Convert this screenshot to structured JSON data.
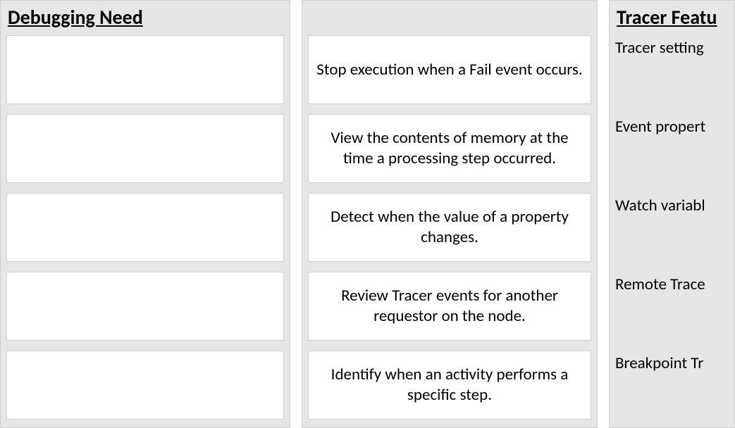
{
  "columns": {
    "left": {
      "header": "Debugging Need",
      "slots": [
        "",
        "",
        "",
        "",
        ""
      ]
    },
    "middle": {
      "cards": [
        "Stop execution when a Fail event occurs.",
        "View the contents of memory at the time a  processing step occurred.",
        "Detect when the value of a property changes.",
        "Review Tracer events for another requestor on the node.",
        "Identify when an activity performs a specific step."
      ]
    },
    "right": {
      "header": "Tracer Featu",
      "features": [
        "Tracer setting",
        "Event propert",
        "Watch variabl",
        "Remote Trace",
        "Breakpoint Tr"
      ]
    }
  }
}
